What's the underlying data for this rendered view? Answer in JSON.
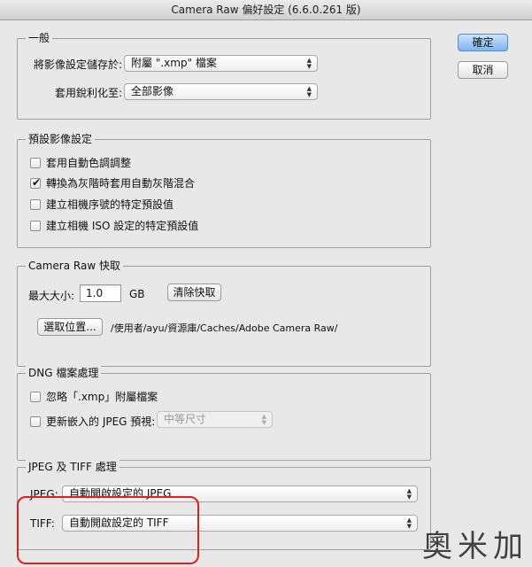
{
  "window": {
    "title": "Camera Raw 偏好設定 (6.6.0.261 版)"
  },
  "buttons": {
    "ok": "確定",
    "cancel": "取消"
  },
  "general": {
    "legend": "一般",
    "save_label": "將影像設定儲存於:",
    "save_value": "附屬 \".xmp\" 檔案",
    "sharpen_label": "套用銳利化至:",
    "sharpen_value": "全部影像"
  },
  "defaults": {
    "legend": "預設影像設定",
    "options": [
      {
        "label": "套用自動色調調整",
        "checked": false
      },
      {
        "label": "轉換為灰階時套用自動灰階混合",
        "checked": true
      },
      {
        "label": "建立相機序號的特定預設值",
        "checked": false
      },
      {
        "label": "建立相機 ISO 設定的特定預設值",
        "checked": false
      }
    ]
  },
  "cache": {
    "legend": "Camera Raw 快取",
    "max_size_label": "最大大小:",
    "max_size_value": "1.0",
    "unit": "GB",
    "purge_button": "清除快取",
    "select_button": "選取位置...",
    "path": "/使用者/ayu/資源庫/Caches/Adobe Camera Raw/"
  },
  "dng": {
    "legend": "DNG 檔案處理",
    "ignore_label": "忽略「.xmp」附屬檔案",
    "ignore_checked": false,
    "update_label": "更新嵌入的 JPEG 預視:",
    "update_checked": false,
    "preview_value": "中等尺寸"
  },
  "jpeg_tiff": {
    "legend": "JPEG 及 TIFF 處理",
    "jpeg_label": "JPEG:",
    "jpeg_value": "自動開啟設定的 JPEG",
    "tiff_label": "TIFF:",
    "tiff_value": "自動開啟設定的 TIFF"
  },
  "watermark": "奧米加",
  "colors": {
    "highlight": "#e0201b",
    "default_button": "#7db4ef"
  }
}
